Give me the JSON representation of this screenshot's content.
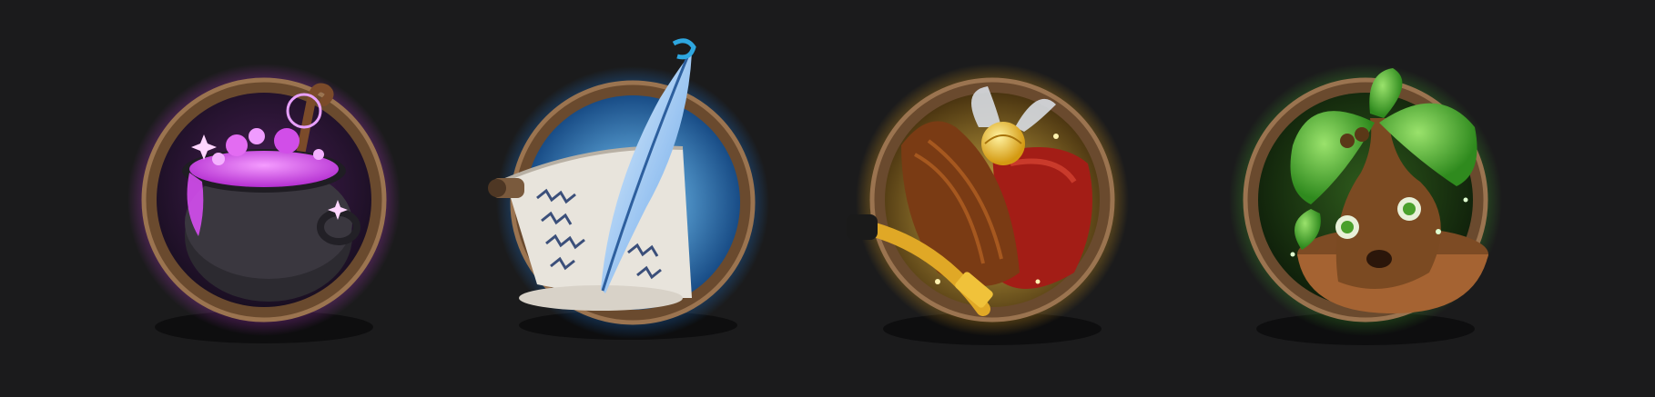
{
  "screen": {
    "background": "#1b1b1c",
    "description_badges": 4
  },
  "badges": [
    {
      "id": "potions",
      "icon": "cauldron-icon",
      "glow_color": "#c23bd6",
      "accent": "#e36cf2"
    },
    {
      "id": "scroll",
      "icon": "quill-scroll-icon",
      "glow_color": "#1f78d6",
      "accent": "#6fb7ff"
    },
    {
      "id": "quidditch",
      "icon": "broom-snitch-icon",
      "glow_color": "#e3a21f",
      "accent": "#f2c23a"
    },
    {
      "id": "herbology",
      "icon": "mandrake-icon",
      "glow_color": "#3e9a2a",
      "accent": "#6fd04a"
    }
  ],
  "frame": {
    "wood_color": "#6a4a2e",
    "wood_highlight": "#9b7450"
  }
}
